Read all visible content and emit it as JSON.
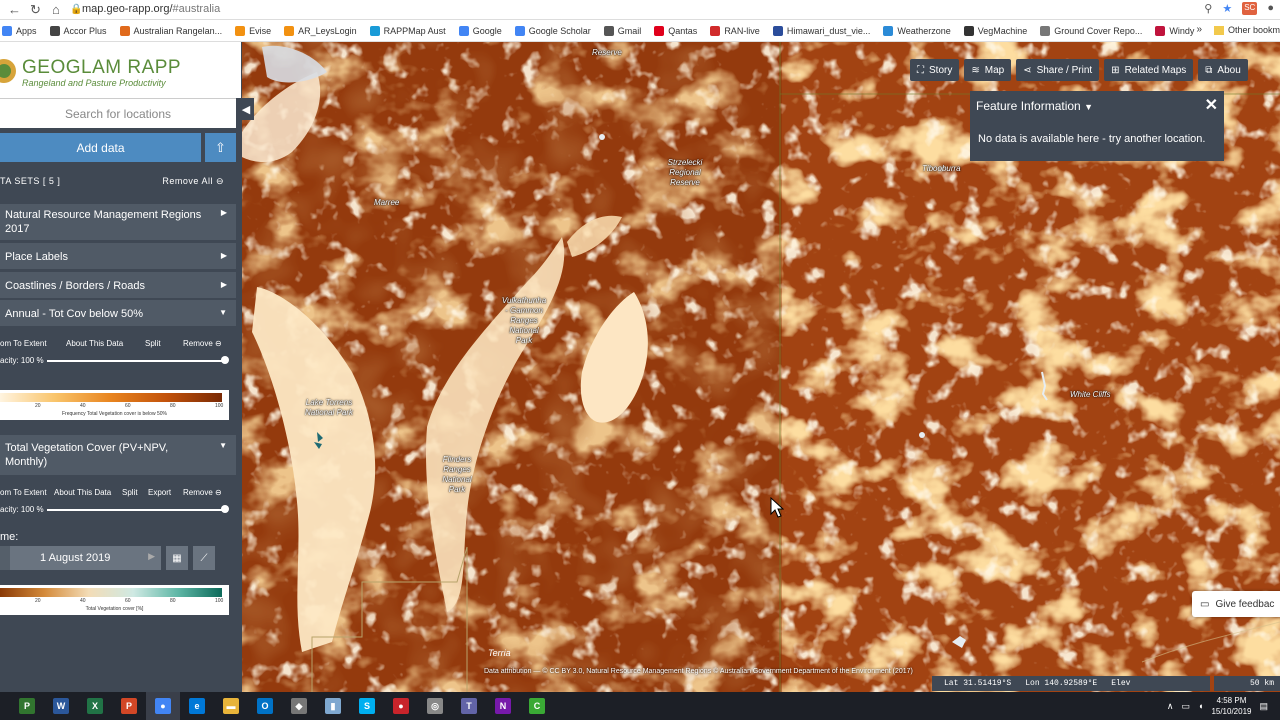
{
  "browser": {
    "url_host": "map.geo-rapp.org/",
    "url_hash": "#australia",
    "profile_badge": "SC",
    "bookmarks": [
      {
        "label": "Apps",
        "color": "#4285f4"
      },
      {
        "label": "Accor Plus",
        "color": "#444444"
      },
      {
        "label": "Australian Rangelan...",
        "color": "#e06a1c"
      },
      {
        "label": "Evise",
        "color": "#f29111"
      },
      {
        "label": "AR_LeysLogin",
        "color": "#f29111"
      },
      {
        "label": "RAPPMap Aust",
        "color": "#1a9bd7"
      },
      {
        "label": "Google",
        "color": "#4285f4"
      },
      {
        "label": "Google Scholar",
        "color": "#4285f4"
      },
      {
        "label": "Gmail",
        "color": "#555555"
      },
      {
        "label": "Qantas",
        "color": "#e0001b"
      },
      {
        "label": "RAN-live",
        "color": "#d12b2b"
      },
      {
        "label": "Himawari_dust_vie...",
        "color": "#2b4d9b"
      },
      {
        "label": "Weatherzone",
        "color": "#2b8bd7"
      },
      {
        "label": "VegMachine",
        "color": "#333333"
      },
      {
        "label": "Ground Cover Repo...",
        "color": "#777777"
      },
      {
        "label": "Windy",
        "color": "#c0143c"
      }
    ],
    "more": "»",
    "other_bookmarks": "Other bookm"
  },
  "workbench": {
    "logo_title": "GEOGLAM RAPP",
    "logo_subtitle": "Rangeland and Pasture Productivity",
    "search_placeholder": "Search for locations",
    "add_data": "Add data",
    "datasets_label": "TA SETS  [ 5 ]",
    "remove_all": "Remove All",
    "datasets": [
      {
        "title": "Natural Resource Management Regions 2017"
      },
      {
        "title": "Place Labels"
      },
      {
        "title": "Coastlines / Borders / Roads"
      },
      {
        "title": "Annual - Tot Cov below 50%"
      },
      {
        "title": "Total Vegetation Cover (PV+NPV, Monthly)"
      }
    ],
    "annual": {
      "controls": [
        "om To Extent",
        "About This Data",
        "Split",
        "Remove"
      ],
      "opacity_label": "acity: 100 %",
      "opacity": 100,
      "legend_ticks": [
        "20",
        "40",
        "60",
        "80",
        "100"
      ],
      "legend_caption": "Frequency Total Vegetation cover is below 50%"
    },
    "tvc": {
      "controls": [
        "om To Extent",
        "About This Data",
        "Split",
        "Export",
        "Remove"
      ],
      "opacity_label": "acity: 100 %",
      "opacity": 100,
      "time_label": "me:",
      "date": "1 August 2019",
      "legend_ticks": [
        "20",
        "40",
        "60",
        "80",
        "100"
      ],
      "legend_caption": "Total Vegetation cover [%]"
    }
  },
  "map": {
    "buttons": [
      {
        "label": "Story",
        "icon": "story-icon"
      },
      {
        "label": "Map",
        "icon": "layers-icon"
      },
      {
        "label": "Share / Print",
        "icon": "share-icon"
      },
      {
        "label": "Related Maps",
        "icon": "grid-icon"
      },
      {
        "label": "Abou",
        "icon": "external-icon"
      }
    ],
    "feature_info": {
      "title": "Feature Information",
      "message": "No data is available here - try another location."
    },
    "labels": {
      "reserve": "Reserve",
      "strzelecki": "Strzelecki Regional Reserve",
      "marree": "Marree",
      "tibooburra": "Tibooburra",
      "vulkathunha": "Vulkathunha - Gammon Ranges National Park",
      "lake_torrens": "Lake Torrens National Park",
      "flinders": "Flinders Ranges National Park",
      "white_cliffs": "White Cliffs"
    },
    "give_feedback": "Give feedbac",
    "attribution": "Data attribution — © CC BY 3.0, Natural Resource Management Regions © Australian Government Department of the Environment (2017)",
    "terria": "Terria",
    "lat": "Lat  31.51419°S",
    "lon": "Lon  140.92589°E",
    "elev": "Elev",
    "scale": "50 km"
  },
  "taskbar": {
    "apps": [
      {
        "name": "project-icon",
        "color": "#31752f",
        "glyph": "P"
      },
      {
        "name": "word-icon",
        "color": "#2b579a",
        "glyph": "W"
      },
      {
        "name": "excel-icon",
        "color": "#217346",
        "glyph": "X"
      },
      {
        "name": "powerpoint-icon",
        "color": "#d24726",
        "glyph": "P"
      },
      {
        "name": "chrome-icon",
        "color": "#4285f4",
        "glyph": "●"
      },
      {
        "name": "edge-icon",
        "color": "#0078d7",
        "glyph": "e"
      },
      {
        "name": "explorer-icon",
        "color": "#e8b43a",
        "glyph": "▬"
      },
      {
        "name": "outlook-icon",
        "color": "#0072c6",
        "glyph": "O"
      },
      {
        "name": "app-icon-a",
        "color": "#777777",
        "glyph": "◆"
      },
      {
        "name": "app-icon-b",
        "color": "#7fa8d0",
        "glyph": "▮"
      },
      {
        "name": "skype-icon",
        "color": "#00aff0",
        "glyph": "S"
      },
      {
        "name": "app-icon-c",
        "color": "#c8242b",
        "glyph": "●"
      },
      {
        "name": "app-icon-d",
        "color": "#888888",
        "glyph": "◎"
      },
      {
        "name": "teams-icon",
        "color": "#6264a7",
        "glyph": "T"
      },
      {
        "name": "onenote-icon",
        "color": "#7719aa",
        "glyph": "N"
      },
      {
        "name": "camtasia-icon",
        "color": "#3aa935",
        "glyph": "C"
      }
    ],
    "time": "4:58 PM",
    "date": "15/10/2019"
  },
  "colors": {
    "panel": "#3f4854",
    "accent": "#4d8bc1",
    "map_base": "#a24312"
  }
}
